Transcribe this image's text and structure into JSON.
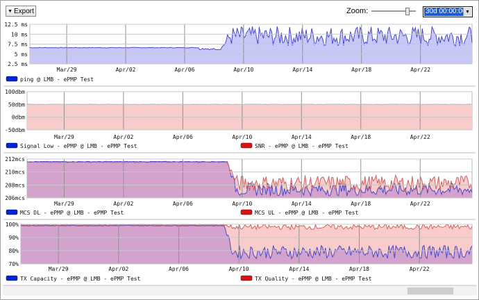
{
  "toolbar": {
    "export_label": "Export",
    "zoom_label": "Zoom:",
    "zoom_value": "30d 00:00:00",
    "zoom_level": 0.85
  },
  "colors": {
    "blue_line": "#4a48c8",
    "blue_fill": "#c8c8f6",
    "red_line": "#d06060",
    "red_fill": "#f9cccc",
    "purple_fill": "#d3a3cd",
    "legend_blue": "#0022dd",
    "legend_red": "#dd1111"
  },
  "x_axis": {
    "labels": [
      "Mar/29",
      "Apr/02",
      "Apr/06",
      "Apr/10",
      "Apr/14",
      "Apr/18",
      "Apr/22"
    ]
  },
  "chart_data": [
    {
      "type": "area",
      "x_dates": [
        "Mar/29",
        "Apr/02",
        "Apr/06",
        "Apr/10",
        "Apr/14",
        "Apr/18",
        "Apr/22"
      ],
      "yticks": [
        "12.5 ms",
        "10 ms",
        "7.5 ms",
        "5 ms",
        "2.5 ms"
      ],
      "ylim": [
        2.5,
        12.5
      ],
      "series": [
        {
          "name": "ping @ LMB - ePMP Test",
          "color": "blue",
          "stable_value": 6.6,
          "stable_end_day": 13,
          "after_range": [
            7,
            12
          ]
        }
      ]
    },
    {
      "type": "area",
      "x_dates": [
        "Mar/29",
        "Apr/02",
        "Apr/06",
        "Apr/10",
        "Apr/14",
        "Apr/18",
        "Apr/22"
      ],
      "yticks": [
        "100dbm",
        "50dbm",
        "0dbm",
        "-50dbm"
      ],
      "ylim": [
        -50,
        100
      ],
      "series": [
        {
          "name": "Signal Low - ePMP @ LMB - ePMP Test",
          "color": "blue",
          "value": -45
        },
        {
          "name": "SNR - ePMP @ LMB - ePMP Test",
          "color": "red",
          "value": 50
        }
      ]
    },
    {
      "type": "area",
      "x_dates": [
        "Mar/29",
        "Apr/02",
        "Apr/06",
        "Apr/10",
        "Apr/14",
        "Apr/18",
        "Apr/22"
      ],
      "yticks": [
        "212mcs",
        "210mcs",
        "208mcs",
        "206mcs"
      ],
      "ylim": [
        206,
        212
      ],
      "series": [
        {
          "name": "MCS DL - ePMP @ LMB - ePMP Test",
          "color": "blue",
          "stable_value": 211.6,
          "stable_end_day": 13.5,
          "after_range": [
            206.3,
            208.3
          ]
        },
        {
          "name": "MCS UL - ePMP @ LMB - ePMP Test",
          "color": "red",
          "stable_value": 211.5,
          "stable_end_day": 13.5,
          "after_range": [
            207,
            209.5
          ]
        }
      ]
    },
    {
      "type": "area",
      "x_dates": [
        "Mar/29",
        "Apr/02",
        "Apr/06",
        "Apr/10",
        "Apr/14",
        "Apr/18",
        "Apr/22"
      ],
      "yticks": [
        "100%",
        "90%",
        "80%",
        "70%"
      ],
      "ylim": [
        70,
        100
      ],
      "series": [
        {
          "name": "TX Capacity - ePMP @ LMB - ePMP Test",
          "color": "blue",
          "stable_value": 99,
          "stable_end_day": 13.5,
          "after_range": [
            74,
            84
          ]
        },
        {
          "name": "TX Quality - ePMP @ LMB - ePMP Test",
          "color": "red",
          "stable_value": 99.5,
          "stable_end_day": 13.5,
          "after_range": [
            96,
            100
          ]
        }
      ]
    }
  ]
}
